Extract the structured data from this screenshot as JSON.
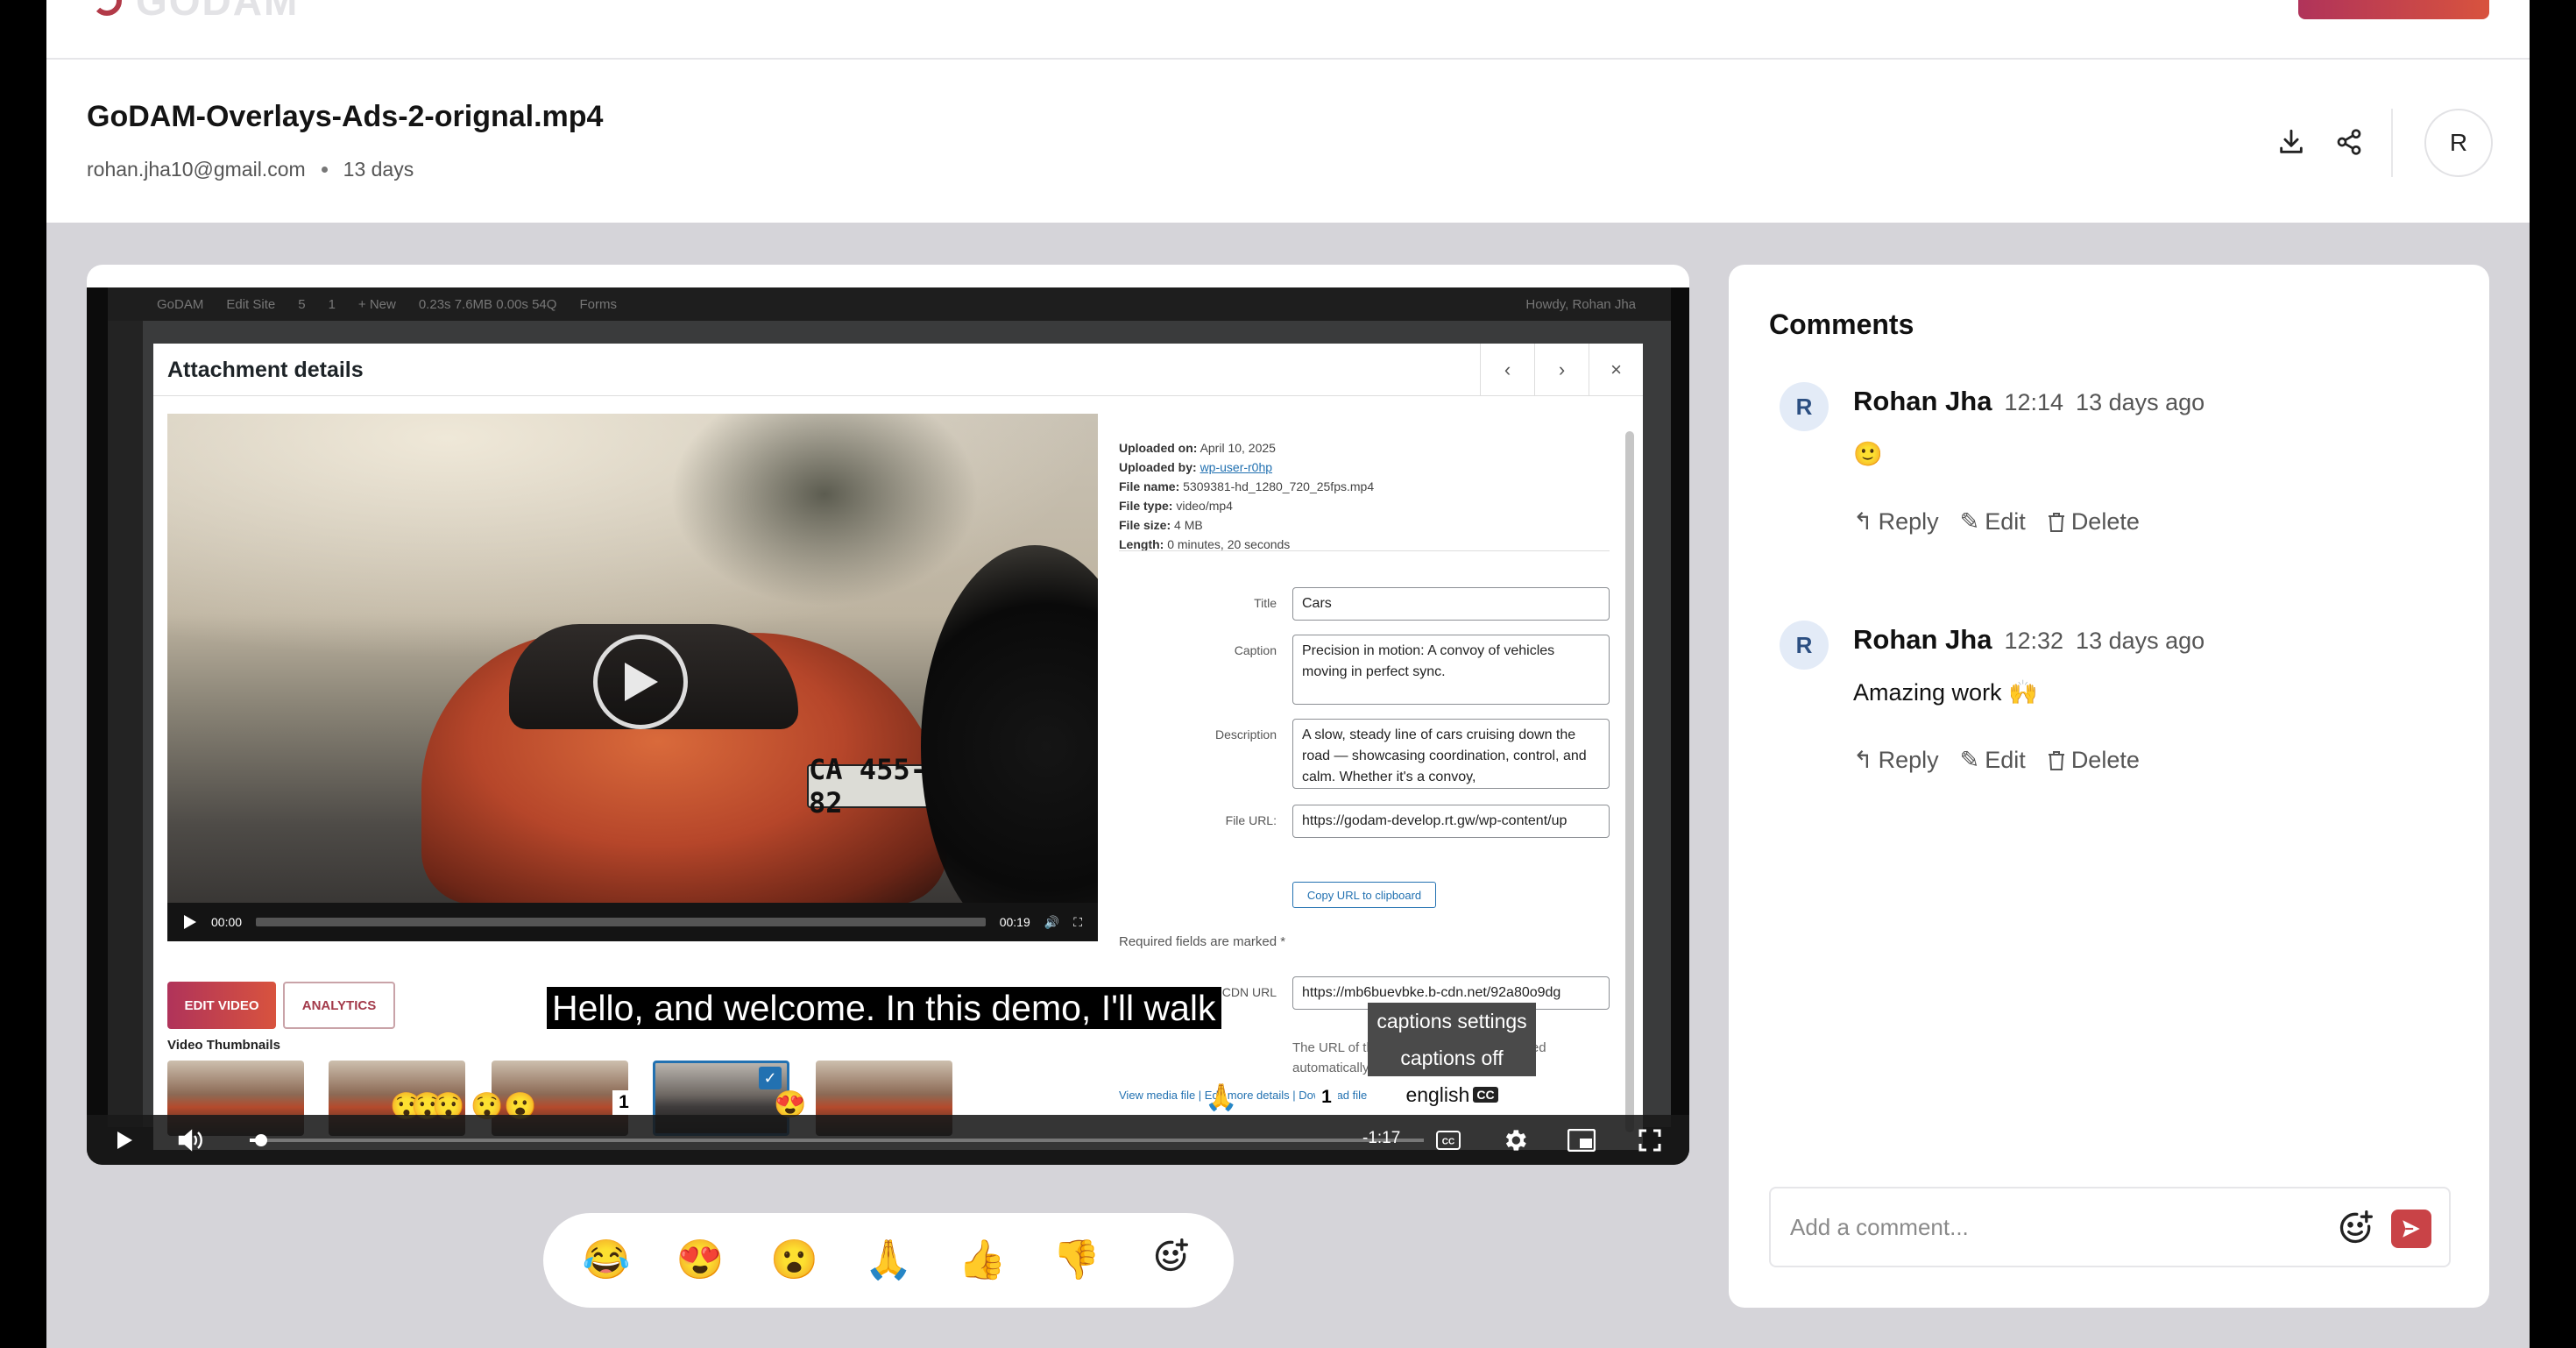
{
  "header": {
    "logo_text": "GODAM",
    "file_title": "GoDAM-Overlays-Ads-2-orignal.mp4",
    "author_email": "rohan.jha10@gmail.com",
    "age": "13 days",
    "user_initial": "R",
    "icons": [
      "download-icon",
      "share-icon"
    ]
  },
  "video": {
    "wp_admin_bar": [
      "GoDAM",
      "Edit Site",
      "5",
      "1",
      "+ New",
      "0.23s 7.6MB 0.00s 54Q",
      "Forms"
    ],
    "wp_howdy": "Howdy, Rohan Jha",
    "modal_title": "Attachment details",
    "modal_nav": {
      "prev": "‹",
      "next": "›",
      "close": "×"
    },
    "inner_player": {
      "plate": "CA 455-82",
      "time_start": "00:00",
      "time_end": "00:19"
    },
    "buttons": {
      "edit": "EDIT VIDEO",
      "analytics": "ANALYTICS"
    },
    "thumbnails_label": "Video Thumbnails",
    "meta": {
      "uploaded_on_label": "Uploaded on:",
      "uploaded_on": "April 10, 2025",
      "uploaded_by_label": "Uploaded by:",
      "uploaded_by": "wp-user-r0hp",
      "file_name_label": "File name:",
      "file_name": "5309381-hd_1280_720_25fps.mp4",
      "file_type_label": "File type:",
      "file_type": "video/mp4",
      "file_size_label": "File size:",
      "file_size": "4 MB",
      "length_label": "Length:",
      "length": "0 minutes, 20 seconds"
    },
    "fields": {
      "title_label": "Title",
      "title": "Cars",
      "caption_label": "Caption",
      "caption": "Precision in motion: A convoy of vehicles moving in perfect sync.",
      "description_label": "Description",
      "description": "A slow, steady line of cars cruising down the road — showcasing coordination, control, and calm. Whether it's a convoy,",
      "file_url_label": "File URL:",
      "file_url": "https://godam-develop.rt.gw/wp-content/up",
      "copy_btn": "Copy URL to clipboard",
      "required_note": "Required fields are marked *",
      "cdn_label": "Transcoded CDN URL",
      "cdn_url": "https://mb6buevbke.b-cdn.net/92a80o9dg",
      "cdn_note": "The URL of the transcoded file is generated automatically and cannot be edited."
    },
    "modal_links": "View media file | Edit more details | Download file | Delete permanently",
    "subtitle": "Hello, and welcome. In this demo, I'll walk",
    "overlay_faces": [
      "😯",
      "😯",
      "😯",
      "😯",
      "😮",
      "😍",
      "🙏"
    ],
    "overlay_counts": [
      "1",
      "1"
    ],
    "captions_menu": {
      "settings": "captions settings",
      "off": "captions off",
      "english": "english",
      "cc": "CC"
    },
    "time_remaining": "-1:17",
    "progress_fraction": 0.01
  },
  "reactions": [
    "😂",
    "😍",
    "😮",
    "🙏",
    "👍",
    "👎"
  ],
  "comments": {
    "title": "Comments",
    "items": [
      {
        "initial": "R",
        "author": "Rohan Jha",
        "time": "12:14",
        "ago": "13 days ago",
        "body": "🙂",
        "reply": "Reply",
        "edit": "Edit",
        "delete": "Delete"
      },
      {
        "initial": "R",
        "author": "Rohan Jha",
        "time": "12:32",
        "ago": "13 days ago",
        "body": "Amazing work 🙌",
        "reply": "Reply",
        "edit": "Edit",
        "delete": "Delete"
      }
    ],
    "input_placeholder": "Add a comment..."
  },
  "colors": {
    "brand": "#c94347",
    "brand_gradient": [
      "#b0335a",
      "#d8533e"
    ],
    "wp_blue": "#2271b1",
    "canvas": "#d5d4d9"
  }
}
